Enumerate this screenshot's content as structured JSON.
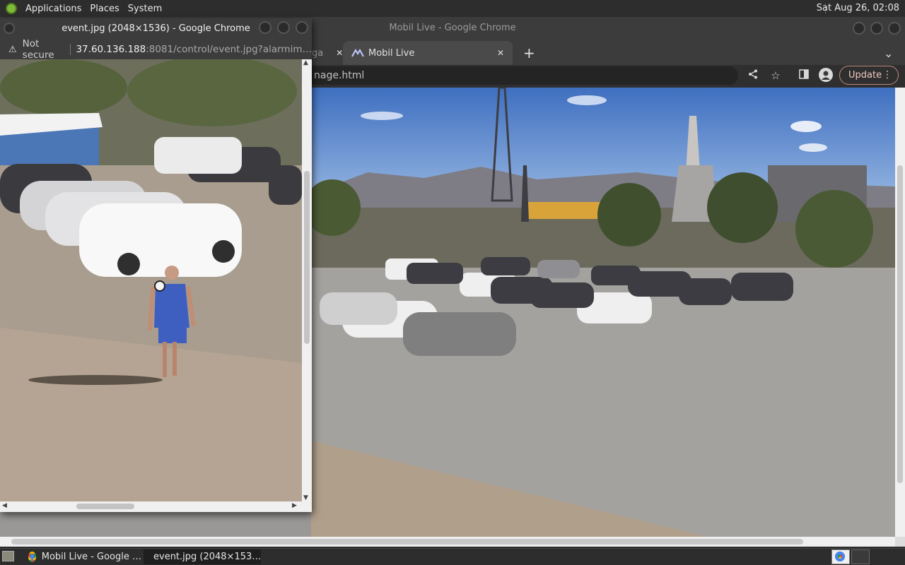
{
  "panel": {
    "menus": [
      "Applications",
      "Places",
      "System"
    ],
    "clock": "Sat Aug 26, 02:08"
  },
  "main_window": {
    "title": "Mobil Live - Google Chrome",
    "tabs": [
      {
        "label": "ga",
        "close": "✕"
      },
      {
        "label": "Mobil Live",
        "close": "✕"
      }
    ],
    "new_tab": "+",
    "tab_menu": "⌄",
    "address_fragment": "nage.html",
    "update_label": "Update"
  },
  "popup_window": {
    "title": "event.jpg (2048×1536) - Google Chrome",
    "security_label": "Not secure",
    "url_host": "37.60.136.188",
    "url_rest": ":8081/control/event.jpg?alarmim…"
  },
  "taskbar": {
    "items": [
      {
        "label": "Mobil Live - Google …"
      },
      {
        "label": "event.jpg (2048×153…"
      }
    ]
  },
  "colors": {
    "panel_bg": "#2d2d2d",
    "titlebar_bg": "#3c3c3c",
    "update_border": "#c08a80"
  }
}
